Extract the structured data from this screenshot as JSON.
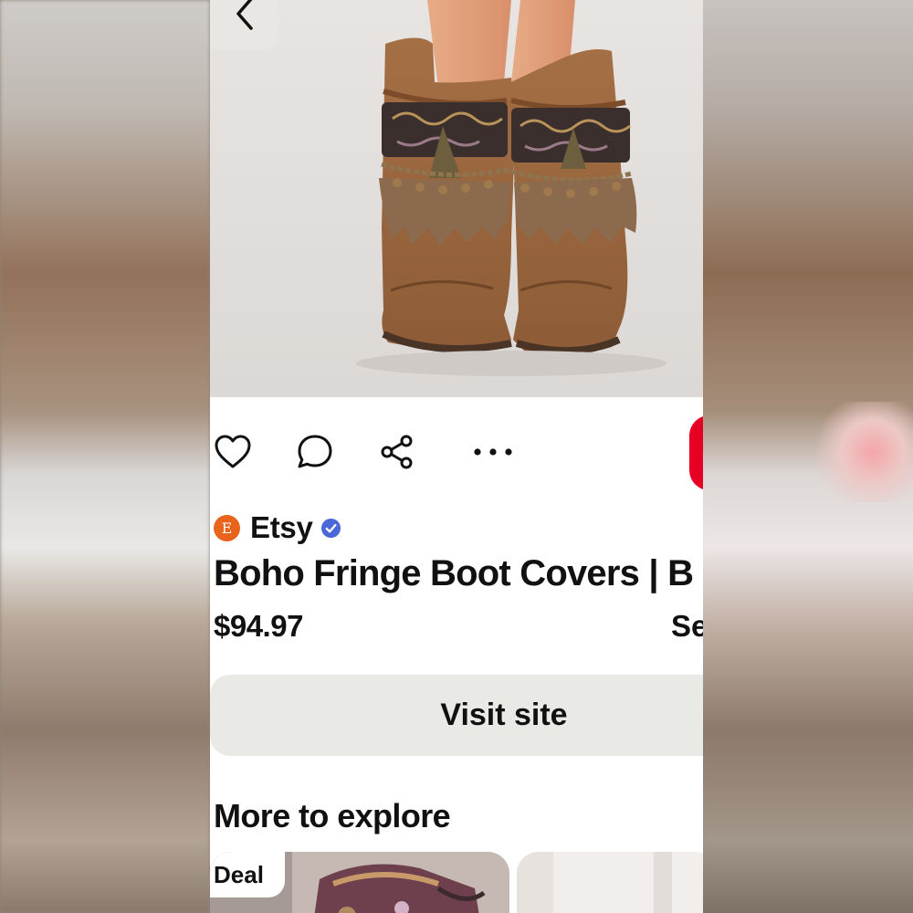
{
  "pin": {
    "source": {
      "avatar_letter": "E",
      "name": "Etsy",
      "verified": true
    },
    "title": "Boho Fringe Boot Covers | B",
    "price": "$94.97",
    "see_more": "Se",
    "visit_label": "Visit site"
  },
  "actions": {
    "icons": [
      "heart-icon",
      "comment-icon",
      "share-icon",
      "more-icon"
    ]
  },
  "explore": {
    "heading": "More to explore",
    "cards": [
      {
        "badge": "Deal"
      },
      {
        "badge": ""
      }
    ]
  },
  "colors": {
    "accent": "#e60023",
    "etsy_orange": "#e8631c",
    "verified_blue": "#4a68d8",
    "button_bg": "#e9e9e6"
  }
}
